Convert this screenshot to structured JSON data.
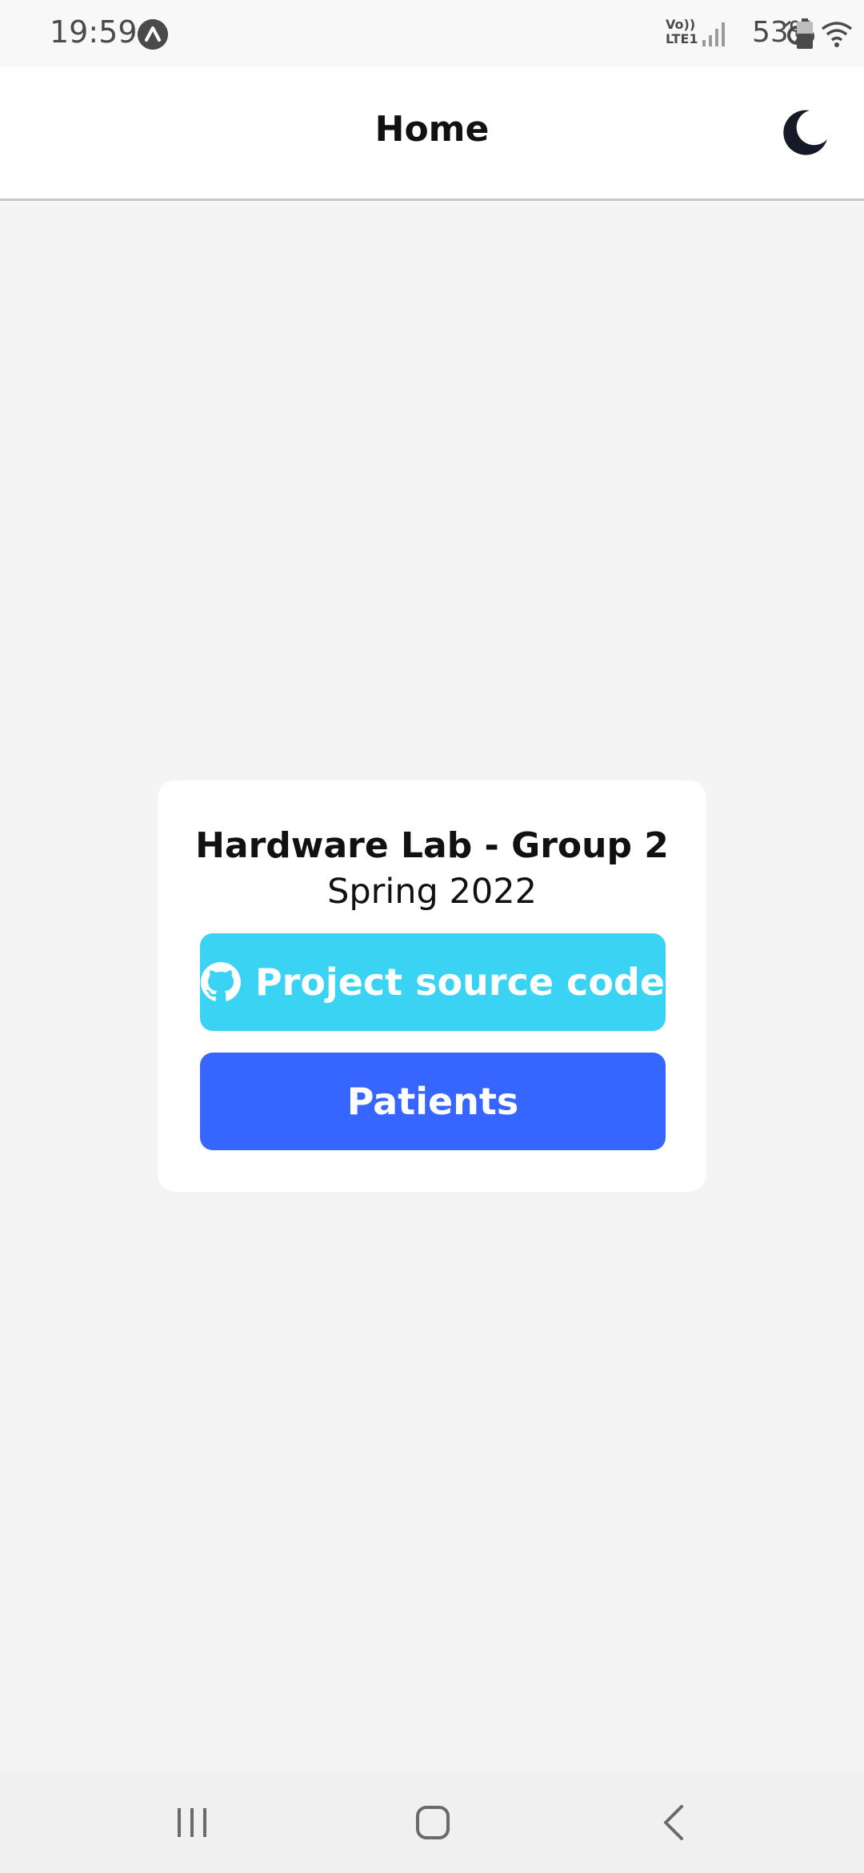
{
  "status_bar": {
    "time": "19:59",
    "battery_percent": "53%",
    "network_label": "Vo)) LTE1"
  },
  "header": {
    "title": "Home",
    "theme_icon": "moon-icon"
  },
  "card": {
    "title": "Hardware Lab - Group 2",
    "subtitle": "Spring 2022",
    "source_button_label": "Project source code",
    "source_button_icon": "github-icon",
    "patients_button_label": "Patients"
  },
  "colors": {
    "accent_cyan": "#3ad3f4",
    "accent_blue": "#3665ff",
    "background": "#f4f4f4"
  },
  "bottom_nav": {
    "recents_icon": "recents-icon",
    "home_icon": "home-icon",
    "back_icon": "back-icon"
  }
}
